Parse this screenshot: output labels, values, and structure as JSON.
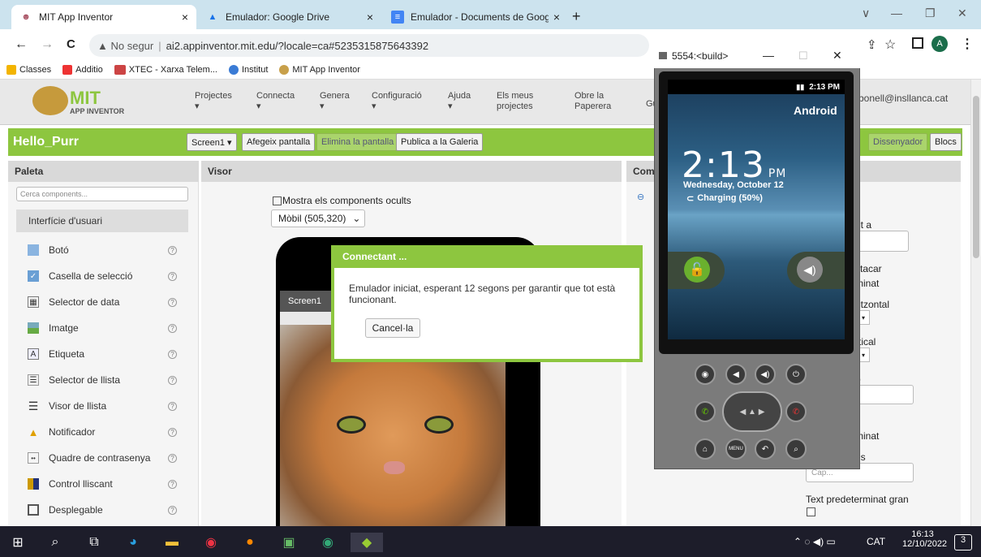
{
  "browser": {
    "tabs": [
      {
        "title": "MIT App Inventor",
        "close": "×"
      },
      {
        "title": "Emulador: Google Drive",
        "close": "×"
      },
      {
        "title": "Emulador - Documents de Googl",
        "close": "×"
      }
    ],
    "new_tab": "+",
    "window_controls": [
      "∨",
      "—",
      "❐",
      "✕"
    ],
    "nav": {
      "back": "←",
      "forward": "→",
      "reload": "C"
    },
    "url_warning": "▲ No segur",
    "url": "ai2.appinventor.mit.edu/?locale=ca#5235315875643392",
    "bookmarks": [
      "Classes",
      "Additio",
      "XTEC - Xarxa Telem...",
      "Institut",
      "MIT App Inventor"
    ],
    "profile_initial": "A"
  },
  "appinventor": {
    "logo_text": "MIT",
    "logo_sub": "APP INVENTOR",
    "menus": [
      "Projectes",
      "Connecta",
      "Genera",
      "Configuració",
      "Ajuda",
      "Els meus projectes",
      "Obre la Paperera",
      "Gu"
    ],
    "user_email": "rbonell@insllanca.cat",
    "project_name": "Hello_Purr",
    "toolbar": {
      "screen_select": "Screen1 ▾",
      "add_screen": "Afegeix pantalla",
      "remove_screen": "Elimina la pantalla",
      "publish": "Publica a la Galeria",
      "designer": "Dissenyador",
      "blocks": "Blocs"
    },
    "palette": {
      "title": "Paleta",
      "search_placeholder": "Cerca components...",
      "category": "Interfície d'usuari",
      "items": [
        "Botó",
        "Casella de selecció",
        "Selector de data",
        "Imatge",
        "Etiqueta",
        "Selector de llista",
        "Visor de llista",
        "Notificador",
        "Quadre de contrasenya",
        "Control lliscant",
        "Desplegable"
      ],
      "help": "?"
    },
    "viewer": {
      "title": "Visor",
      "show_hidden": "Mostra els components ocults",
      "device": "Mòbil (505,320)",
      "screen_title": "Screen1"
    },
    "components": {
      "title": "Com"
    },
    "properties": {
      "fragments": [
        "nt a",
        "stacar",
        "minat",
        "ritzontal",
        "rtical",
        "p",
        "s",
        "minat",
        "ns",
        "Text predeterminat gran"
      ],
      "placeholder": "Cap..."
    }
  },
  "dialog": {
    "title": "Connectant ...",
    "message": "Emulador iniciat, esperant 12 segons per garantir que tot està funcionant.",
    "cancel": "Cancel·la"
  },
  "emulator": {
    "window_title": "5554:<build>",
    "status_time": "2:13 PM",
    "carrier": "Android",
    "clock": "2:13",
    "clock_ampm": "PM",
    "date": "Wednesday, October 12",
    "charging": "Charging (50%)",
    "menu_label": "MENU"
  },
  "taskbar": {
    "language": "CAT",
    "time": "16:13",
    "date": "12/10/2022",
    "notifications": "3"
  }
}
